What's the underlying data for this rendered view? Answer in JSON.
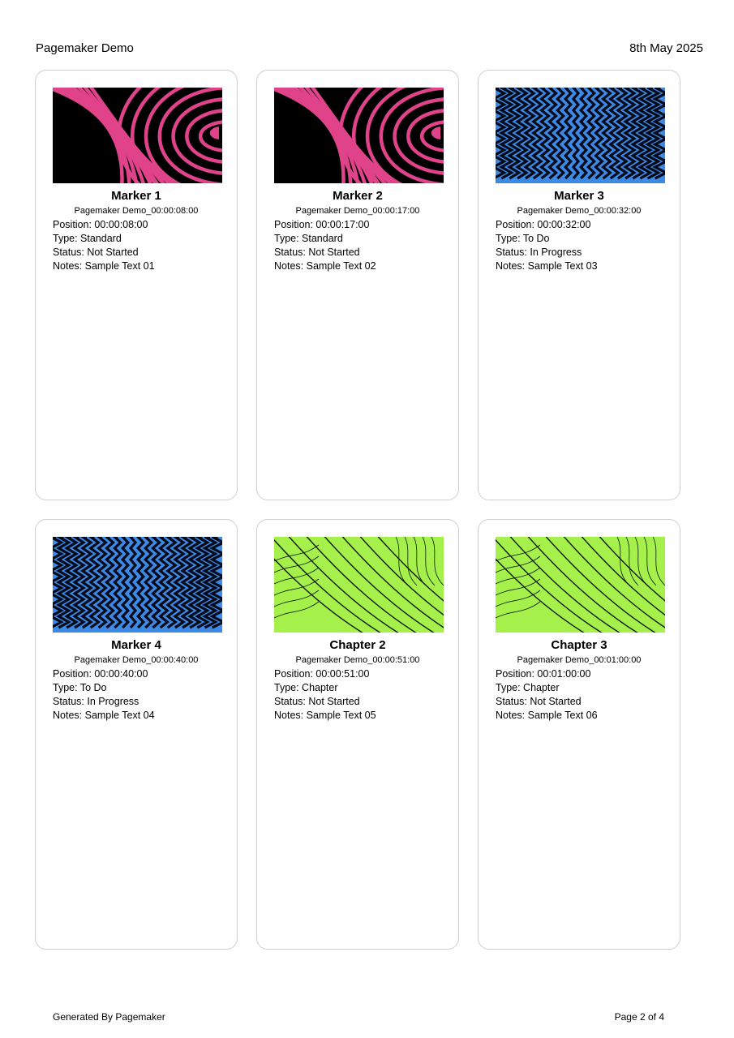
{
  "header": {
    "title": "Pagemaker Demo",
    "date": "8th May 2025"
  },
  "labels": {
    "position": "Position: ",
    "type": "Type: ",
    "status": "Status: ",
    "notes": "Notes: "
  },
  "cards": [
    {
      "title": "Marker 1",
      "subtitle": "Pagemaker Demo_00:00:08:00",
      "position": "00:00:08:00",
      "type": "Standard",
      "status": "Not Started",
      "notes": "Sample Text 01",
      "thumb": "pink-waves",
      "thumb_color": "#e0438a"
    },
    {
      "title": "Marker 2",
      "subtitle": "Pagemaker Demo_00:00:17:00",
      "position": "00:00:17:00",
      "type": "Standard",
      "status": "Not Started",
      "notes": "Sample Text 02",
      "thumb": "pink-waves",
      "thumb_color": "#e0438a"
    },
    {
      "title": "Marker 3",
      "subtitle": "Pagemaker Demo_00:00:32:00",
      "position": "00:00:32:00",
      "type": "To Do",
      "status": "In Progress",
      "notes": "Sample Text 03",
      "thumb": "blue-zigzag",
      "thumb_color": "#3d8ae6"
    },
    {
      "title": "Marker 4",
      "subtitle": "Pagemaker Demo_00:00:40:00",
      "position": "00:00:40:00",
      "type": "To Do",
      "status": "In Progress",
      "notes": "Sample Text 04",
      "thumb": "blue-zigzag",
      "thumb_color": "#3d8ae6"
    },
    {
      "title": "Chapter 2",
      "subtitle": "Pagemaker Demo_00:00:51:00",
      "position": "00:00:51:00",
      "type": "Chapter",
      "status": "Not Started",
      "notes": "Sample Text 05",
      "thumb": "green-lines",
      "thumb_color": "#a6f04c"
    },
    {
      "title": "Chapter 3",
      "subtitle": "Pagemaker Demo_00:01:00:00",
      "position": "00:01:00:00",
      "type": "Chapter",
      "status": "Not Started",
      "notes": "Sample Text 06",
      "thumb": "green-lines",
      "thumb_color": "#a6f04c"
    }
  ],
  "footer": {
    "generated": "Generated By Pagemaker",
    "page": "Page 2 of 4"
  }
}
